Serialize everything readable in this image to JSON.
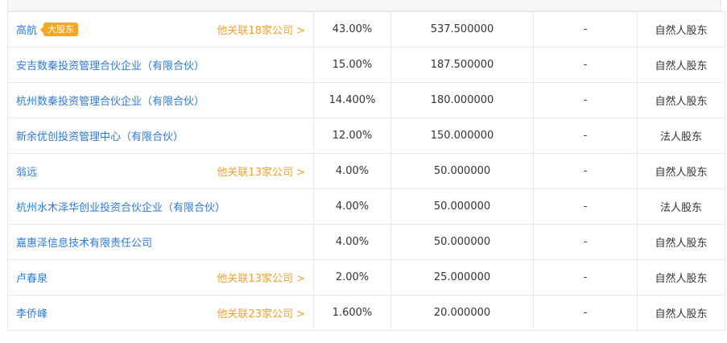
{
  "badge_major": "大股东",
  "chevron": "›",
  "rows": [
    {
      "name": "高航",
      "major": true,
      "related": "他关联18家公司 >",
      "pct": "43.00%",
      "amount": "537.500000",
      "dash": "-",
      "type": "自然人股东"
    },
    {
      "name": "安吉数秦投资管理合伙企业（有限合伙）",
      "major": false,
      "related": "",
      "pct": "15.00%",
      "amount": "187.500000",
      "dash": "-",
      "type": "自然人股东"
    },
    {
      "name": "杭州数秦投资管理合伙企业（有限合伙）",
      "major": false,
      "related": "",
      "pct": "14.400%",
      "amount": "180.000000",
      "dash": "-",
      "type": "自然人股东"
    },
    {
      "name": "新余优创投资管理中心（有限合伙）",
      "major": false,
      "related": "",
      "pct": "12.00%",
      "amount": "150.000000",
      "dash": "-",
      "type": "法人股东"
    },
    {
      "name": "翁远",
      "major": false,
      "related": "他关联13家公司 >",
      "pct": "4.00%",
      "amount": "50.000000",
      "dash": "-",
      "type": "自然人股东"
    },
    {
      "name": "杭州水木泽华创业投资合伙企业（有限合伙）",
      "major": false,
      "related": "",
      "pct": "4.00%",
      "amount": "50.000000",
      "dash": "-",
      "type": "法人股东"
    },
    {
      "name": "嘉惠泽信息技术有限责任公司",
      "major": false,
      "related": "",
      "pct": "4.00%",
      "amount": "50.000000",
      "dash": "-",
      "type": "自然人股东"
    },
    {
      "name": "卢春泉",
      "major": false,
      "related": "他关联13家公司 >",
      "pct": "2.00%",
      "amount": "25.000000",
      "dash": "-",
      "type": "自然人股东"
    },
    {
      "name": "李侨峰",
      "major": false,
      "related": "他关联23家公司 >",
      "pct": "1.600%",
      "amount": "20.000000",
      "dash": "-",
      "type": "自然人股东"
    }
  ],
  "colors": {
    "link": "#2b7ad8",
    "related": "#f0a030",
    "badge": "#f5a623",
    "border": "#e8e8e8"
  }
}
